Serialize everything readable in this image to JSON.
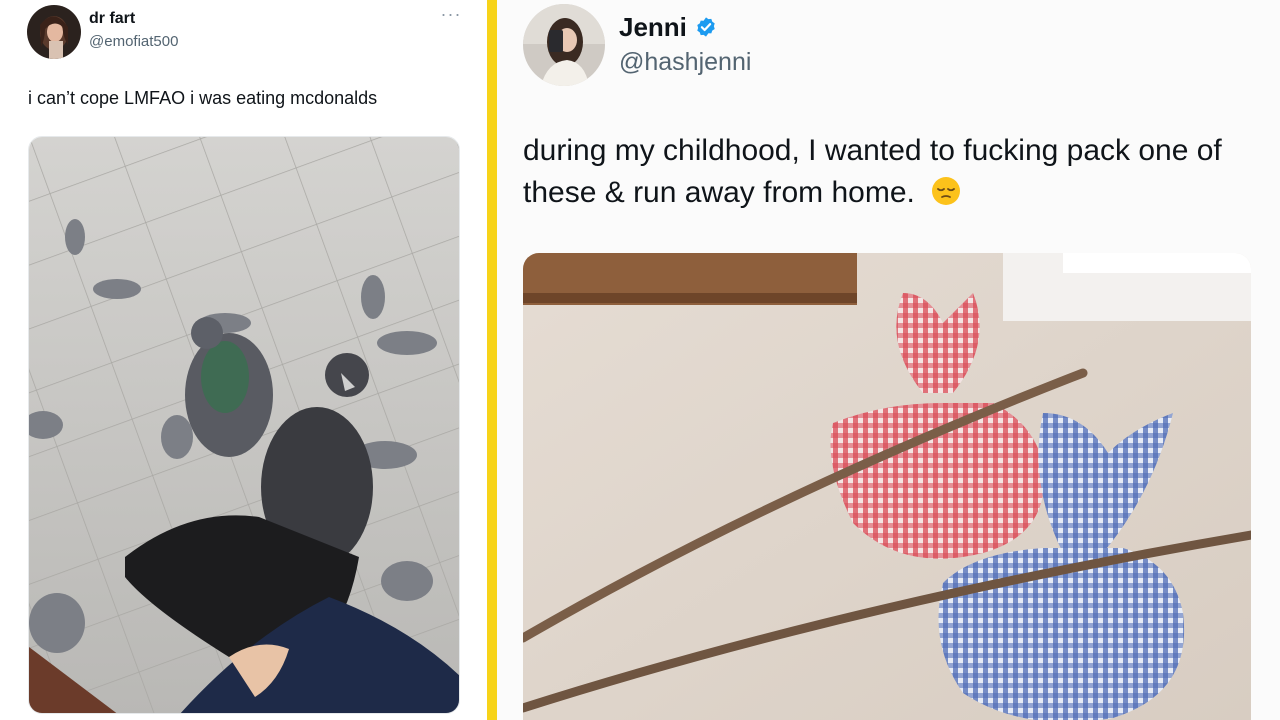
{
  "left_tweet": {
    "display_name": "dr fart",
    "handle": "@emofiat500",
    "more_icon": "more-horizontal-icon",
    "text": "i can’t cope LMFAO i was eating mcdonalds",
    "media_description_icon": "photo"
  },
  "right_tweet": {
    "display_name": "Jenni",
    "verified_icon": "verified-badge-icon",
    "handle": "@hashjenni",
    "text": "during my childhood, I wanted to fucking pack one of these & run away from home.",
    "emoji": "pensive-face-emoji"
  },
  "colors": {
    "divider": "#f7d318",
    "verified": "#1d9bf0",
    "handle": "#536471",
    "text": "#0f1419"
  }
}
